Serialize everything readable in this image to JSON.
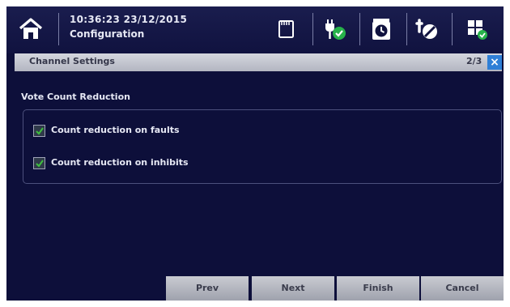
{
  "header": {
    "datetime": "10:36:23 23/12/2015",
    "mode": "Configuration",
    "icons": [
      "home-icon",
      "memory-card-icon",
      "plug-ok-icon",
      "alarm-clock-icon",
      "tools-disabled-icon",
      "grid-menu-icon"
    ]
  },
  "dialog": {
    "title": "Channel Settings",
    "page_indicator": "2/3",
    "close_label": "×",
    "section_title": "Vote Count Reduction",
    "options": [
      {
        "label": "Count reduction on faults",
        "checked": true
      },
      {
        "label": "Count reduction on inhibits",
        "checked": true
      }
    ]
  },
  "buttons": {
    "prev": "Prev",
    "next": "Next",
    "finish": "Finish",
    "cancel": "Cancel"
  },
  "colors": {
    "background": "#0d0f3a",
    "titlebar": "#c4c6cf",
    "accent_blue": "#2f7fd6",
    "check_green": "#3fbf3f",
    "status_green": "#27b24a"
  }
}
